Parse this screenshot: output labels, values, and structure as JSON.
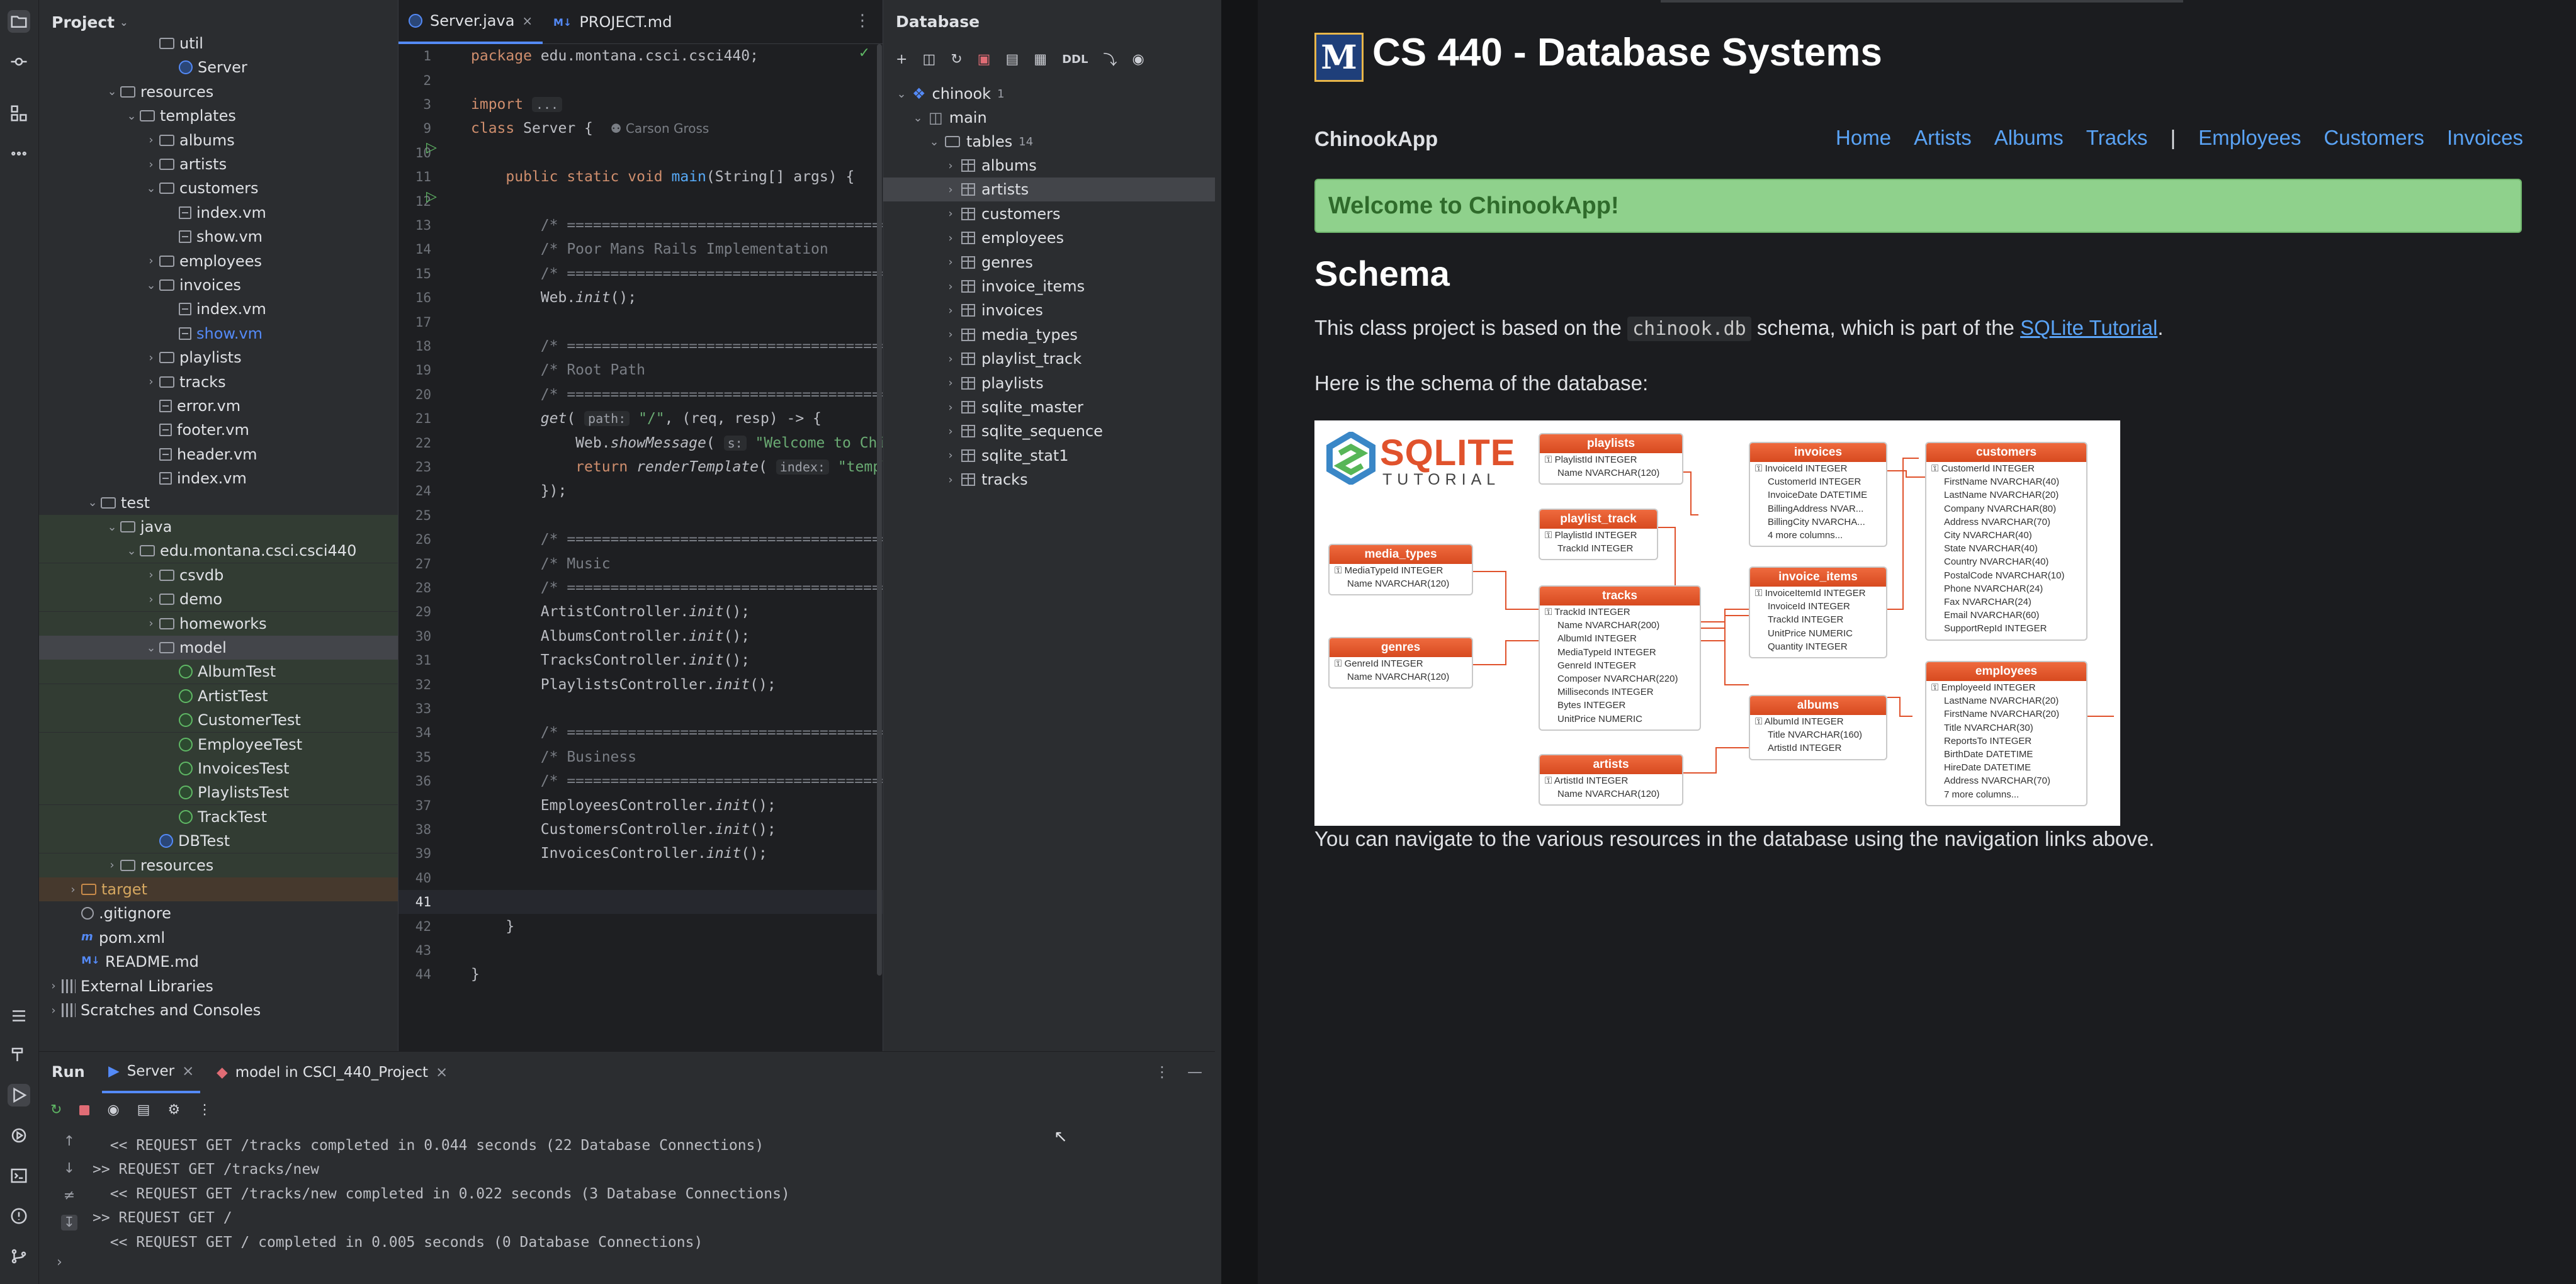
{
  "ide": {
    "project": {
      "title": "Project",
      "tree": [
        {
          "label": "util",
          "depth": 4,
          "arrow": "",
          "icon": "folder"
        },
        {
          "label": "Server",
          "depth": 5,
          "arrow": "",
          "icon": "class"
        },
        {
          "label": "resources",
          "depth": 2,
          "arrow": "v",
          "icon": "folder"
        },
        {
          "label": "templates",
          "depth": 3,
          "arrow": "v",
          "icon": "folder"
        },
        {
          "label": "albums",
          "depth": 4,
          "arrow": ">",
          "icon": "folder"
        },
        {
          "label": "artists",
          "depth": 4,
          "arrow": ">",
          "icon": "folder"
        },
        {
          "label": "customers",
          "depth": 4,
          "arrow": "v",
          "icon": "folder"
        },
        {
          "label": "index.vm",
          "depth": 5,
          "arrow": "",
          "icon": "vm"
        },
        {
          "label": "show.vm",
          "depth": 5,
          "arrow": "",
          "icon": "vm"
        },
        {
          "label": "employees",
          "depth": 4,
          "arrow": ">",
          "icon": "folder"
        },
        {
          "label": "invoices",
          "depth": 4,
          "arrow": "v",
          "icon": "folder"
        },
        {
          "label": "index.vm",
          "depth": 5,
          "arrow": "",
          "icon": "vm"
        },
        {
          "label": "show.vm",
          "depth": 5,
          "arrow": "",
          "icon": "vm",
          "hl": true
        },
        {
          "label": "playlists",
          "depth": 4,
          "arrow": ">",
          "icon": "folder"
        },
        {
          "label": "tracks",
          "depth": 4,
          "arrow": ">",
          "icon": "folder"
        },
        {
          "label": "error.vm",
          "depth": 4,
          "arrow": "",
          "icon": "vm"
        },
        {
          "label": "footer.vm",
          "depth": 4,
          "arrow": "",
          "icon": "vm"
        },
        {
          "label": "header.vm",
          "depth": 4,
          "arrow": "",
          "icon": "vm"
        },
        {
          "label": "index.vm",
          "depth": 4,
          "arrow": "",
          "icon": "vm"
        },
        {
          "label": "test",
          "depth": 1,
          "arrow": "v",
          "icon": "folder"
        },
        {
          "label": "java",
          "depth": 2,
          "arrow": "v",
          "icon": "folder",
          "green": true
        },
        {
          "label": "edu.montana.csci.csci440",
          "depth": 3,
          "arrow": "v",
          "icon": "folder",
          "green": true
        },
        {
          "label": "csvdb",
          "depth": 4,
          "arrow": ">",
          "icon": "folder",
          "green": true
        },
        {
          "label": "demo",
          "depth": 4,
          "arrow": ">",
          "icon": "folder",
          "green": true
        },
        {
          "label": "homeworks",
          "depth": 4,
          "arrow": ">",
          "icon": "folder",
          "green": true
        },
        {
          "label": "model",
          "depth": 4,
          "arrow": "v",
          "icon": "folder",
          "sel": true
        },
        {
          "label": "AlbumTest",
          "depth": 5,
          "arrow": "",
          "icon": "test",
          "green": true
        },
        {
          "label": "ArtistTest",
          "depth": 5,
          "arrow": "",
          "icon": "test",
          "green": true
        },
        {
          "label": "CustomerTest",
          "depth": 5,
          "arrow": "",
          "icon": "test",
          "green": true
        },
        {
          "label": "EmployeeTest",
          "depth": 5,
          "arrow": "",
          "icon": "test",
          "green": true
        },
        {
          "label": "InvoicesTest",
          "depth": 5,
          "arrow": "",
          "icon": "test",
          "green": true
        },
        {
          "label": "PlaylistsTest",
          "depth": 5,
          "arrow": "",
          "icon": "test",
          "green": true
        },
        {
          "label": "TrackTest",
          "depth": 5,
          "arrow": "",
          "icon": "test",
          "green": true
        },
        {
          "label": "DBTest",
          "depth": 4,
          "arrow": "",
          "icon": "class",
          "green": true
        },
        {
          "label": "resources",
          "depth": 2,
          "arrow": ">",
          "icon": "folder",
          "green": true
        },
        {
          "label": "target",
          "depth": 0,
          "arrow": ">",
          "icon": "folder",
          "orange": true
        },
        {
          "label": ".gitignore",
          "depth": 0,
          "arrow": "",
          "icon": "git"
        },
        {
          "label": "pom.xml",
          "depth": 0,
          "arrow": "",
          "icon": "m"
        },
        {
          "label": "README.md",
          "depth": 0,
          "arrow": "",
          "icon": "md"
        },
        {
          "label": "External Libraries",
          "depth": -1,
          "arrow": ">",
          "icon": "lib"
        },
        {
          "label": "Scratches and Consoles",
          "depth": -1,
          "arrow": ">",
          "icon": "lib"
        }
      ]
    },
    "editor": {
      "tabs": [
        {
          "label": "Server.java",
          "active": true
        },
        {
          "label": "PROJECT.md",
          "active": false
        }
      ],
      "lines": [
        {
          "n": "1",
          "html": "<span class='kw'>package</span> edu.montana.csci.csci440;"
        },
        {
          "n": "2",
          "html": ""
        },
        {
          "n": "3",
          "html": "<span class='kw'>import</span> <span class='hint'>...</span>"
        },
        {
          "n": "9",
          "html": "<span class='kw'>class</span> Server {  <span class='cm' style='font-family:DejaVu Sans,sans-serif;font-size:20px'>&#9865; Carson Gross</span>"
        },
        {
          "n": "10",
          "html": ""
        },
        {
          "n": "11",
          "html": "    <span class='kw'>public static void</span> <span class='fn'>main</span>(String[] args) {"
        },
        {
          "n": "12",
          "html": ""
        },
        {
          "n": "13",
          "html": "        <span class='cm'>/* ===========================================</span>"
        },
        {
          "n": "14",
          "html": "        <span class='cm'>/* Poor Mans Rails Implementation</span>"
        },
        {
          "n": "15",
          "html": "        <span class='cm'>/* ===========================================</span>"
        },
        {
          "n": "16",
          "html": "        Web.<span class='it'>init</span>();"
        },
        {
          "n": "17",
          "html": ""
        },
        {
          "n": "18",
          "html": "        <span class='cm'>/* ===========================================</span>"
        },
        {
          "n": "19",
          "html": "        <span class='cm'>/* Root Path</span>"
        },
        {
          "n": "20",
          "html": "        <span class='cm'>/* ===========================================</span>"
        },
        {
          "n": "21",
          "html": "        <span class='it'>get</span>( <span class='hint'>path:</span> <span class='str'>\"/\"</span>, (req, resp) -> {"
        },
        {
          "n": "22",
          "html": "            Web.<span class='it'>showMessage</span>( <span class='hint'>s:</span> <span class='str'>\"Welcome to Chinoo</span>"
        },
        {
          "n": "23",
          "html": "            <span class='kw'>return</span> <span class='it'>renderTemplate</span>( <span class='hint'>index:</span> <span class='str'>\"template</span>"
        },
        {
          "n": "24",
          "html": "        });"
        },
        {
          "n": "25",
          "html": ""
        },
        {
          "n": "26",
          "html": "        <span class='cm'>/* ===========================================</span>"
        },
        {
          "n": "27",
          "html": "        <span class='cm'>/* Music</span>"
        },
        {
          "n": "28",
          "html": "        <span class='cm'>/* ===========================================</span>"
        },
        {
          "n": "29",
          "html": "        ArtistController.<span class='it'>init</span>();"
        },
        {
          "n": "30",
          "html": "        AlbumsController.<span class='it'>init</span>();"
        },
        {
          "n": "31",
          "html": "        TracksController.<span class='it'>init</span>();"
        },
        {
          "n": "32",
          "html": "        PlaylistsController.<span class='it'>init</span>();"
        },
        {
          "n": "33",
          "html": ""
        },
        {
          "n": "34",
          "html": "        <span class='cm'>/* ===========================================</span>"
        },
        {
          "n": "35",
          "html": "        <span class='cm'>/* Business</span>"
        },
        {
          "n": "36",
          "html": "        <span class='cm'>/* ===========================================</span>"
        },
        {
          "n": "37",
          "html": "        EmployeesController.<span class='it'>init</span>();"
        },
        {
          "n": "38",
          "html": "        CustomersController.<span class='it'>init</span>();"
        },
        {
          "n": "39",
          "html": "        InvoicesController.<span class='it'>init</span>();"
        },
        {
          "n": "40",
          "html": ""
        },
        {
          "n": "41",
          "html": ""
        },
        {
          "n": "42",
          "html": "    }"
        },
        {
          "n": "43",
          "html": ""
        },
        {
          "n": "44",
          "html": "}"
        }
      ]
    },
    "database": {
      "title": "Database",
      "ddl": "DDL",
      "root": "chinook",
      "root_count": "1",
      "schema": "main",
      "tables_label": "tables",
      "tables_count": "14",
      "tables": [
        "albums",
        "artists",
        "customers",
        "employees",
        "genres",
        "invoice_items",
        "invoices",
        "media_types",
        "playlist_track",
        "playlists",
        "sqlite_master",
        "sqlite_sequence",
        "sqlite_stat1",
        "tracks"
      ],
      "selected": "artists"
    },
    "run": {
      "title": "Run",
      "tabs": [
        {
          "label": "Server",
          "active": true
        },
        {
          "label": "model in CSCI_440_Project",
          "active": false
        }
      ],
      "lines": [
        "  << REQUEST GET /tracks completed in 0.044 seconds (22 Database Connections)",
        ">> REQUEST GET /tracks/new",
        "  << REQUEST GET /tracks/new completed in 0.022 seconds (3 Database Connections)",
        ">> REQUEST GET /",
        "  << REQUEST GET / completed in 0.005 seconds (0 Database Connections)"
      ]
    }
  },
  "browser": {
    "logo": "M",
    "title": "CS 440 - Database Systems",
    "brand": "ChinookApp",
    "nav": [
      "Home",
      "Artists",
      "Albums",
      "Tracks",
      "|",
      "Employees",
      "Customers",
      "Invoices"
    ],
    "alert": "Welcome to ChinookApp!",
    "schema_heading": "Schema",
    "p1_before": "This class project is based on the",
    "p1_code": "chinook.db",
    "p1_mid": "schema, which is part of the",
    "p1_link": "SQLite Tutorial",
    "p1_end": ".",
    "p2": "Here is the schema of the database:",
    "p3": "You can navigate to the various resources in the database using the navigation links above.",
    "diagram": {
      "logo_top": "SQLITE",
      "logo_bottom": "TUTORIAL",
      "tables": [
        {
          "name": "playlists",
          "fields": [
            "PlaylistId  INTEGER",
            "Name  NVARCHAR(120)"
          ]
        },
        {
          "name": "playlist_track",
          "fields": [
            "PlaylistId  INTEGER",
            "TrackId  INTEGER"
          ]
        },
        {
          "name": "media_types",
          "fields": [
            "MediaTypeId  INTEGER",
            "Name  NVARCHAR(120)"
          ]
        },
        {
          "name": "genres",
          "fields": [
            "GenreId  INTEGER",
            "Name  NVARCHAR(120)"
          ]
        },
        {
          "name": "tracks",
          "fields": [
            "TrackId  INTEGER",
            "Name  NVARCHAR(200)",
            "AlbumId  INTEGER",
            "MediaTypeId  INTEGER",
            "GenreId  INTEGER",
            "Composer  NVARCHAR(220)",
            "Milliseconds  INTEGER",
            "Bytes  INTEGER",
            "UnitPrice  NUMERIC"
          ]
        },
        {
          "name": "artists",
          "fields": [
            "ArtistId  INTEGER",
            "Name  NVARCHAR(120)"
          ]
        },
        {
          "name": "invoices",
          "fields": [
            "InvoiceId  INTEGER",
            "CustomerId  INTEGER",
            "InvoiceDate  DATETIME",
            "BillingAddress  NVAR...",
            "BillingCity  NVARCHA...",
            "4 more columns..."
          ]
        },
        {
          "name": "invoice_items",
          "fields": [
            "InvoiceItemId  INTEGER",
            "InvoiceId  INTEGER",
            "TrackId  INTEGER",
            "UnitPrice  NUMERIC",
            "Quantity  INTEGER"
          ]
        },
        {
          "name": "albums",
          "fields": [
            "AlbumId  INTEGER",
            "Title  NVARCHAR(160)",
            "ArtistId  INTEGER"
          ]
        },
        {
          "name": "customers",
          "fields": [
            "CustomerId  INTEGER",
            "FirstName  NVARCHAR(40)",
            "LastName  NVARCHAR(20)",
            "Company  NVARCHAR(80)",
            "Address  NVARCHAR(70)",
            "City  NVARCHAR(40)",
            "State  NVARCHAR(40)",
            "Country  NVARCHAR(40)",
            "PostalCode  NVARCHAR(10)",
            "Phone  NVARCHAR(24)",
            "Fax  NVARCHAR(24)",
            "Email  NVARCHAR(60)",
            "SupportRepId  INTEGER"
          ]
        },
        {
          "name": "employees",
          "fields": [
            "EmployeeId  INTEGER",
            "LastName  NVARCHAR(20)",
            "FirstName  NVARCHAR(20)",
            "Title  NVARCHAR(30)",
            "ReportsTo  INTEGER",
            "BirthDate  DATETIME",
            "HireDate  DATETIME",
            "Address  NVARCHAR(70)",
            "7 more columns..."
          ]
        }
      ]
    }
  }
}
